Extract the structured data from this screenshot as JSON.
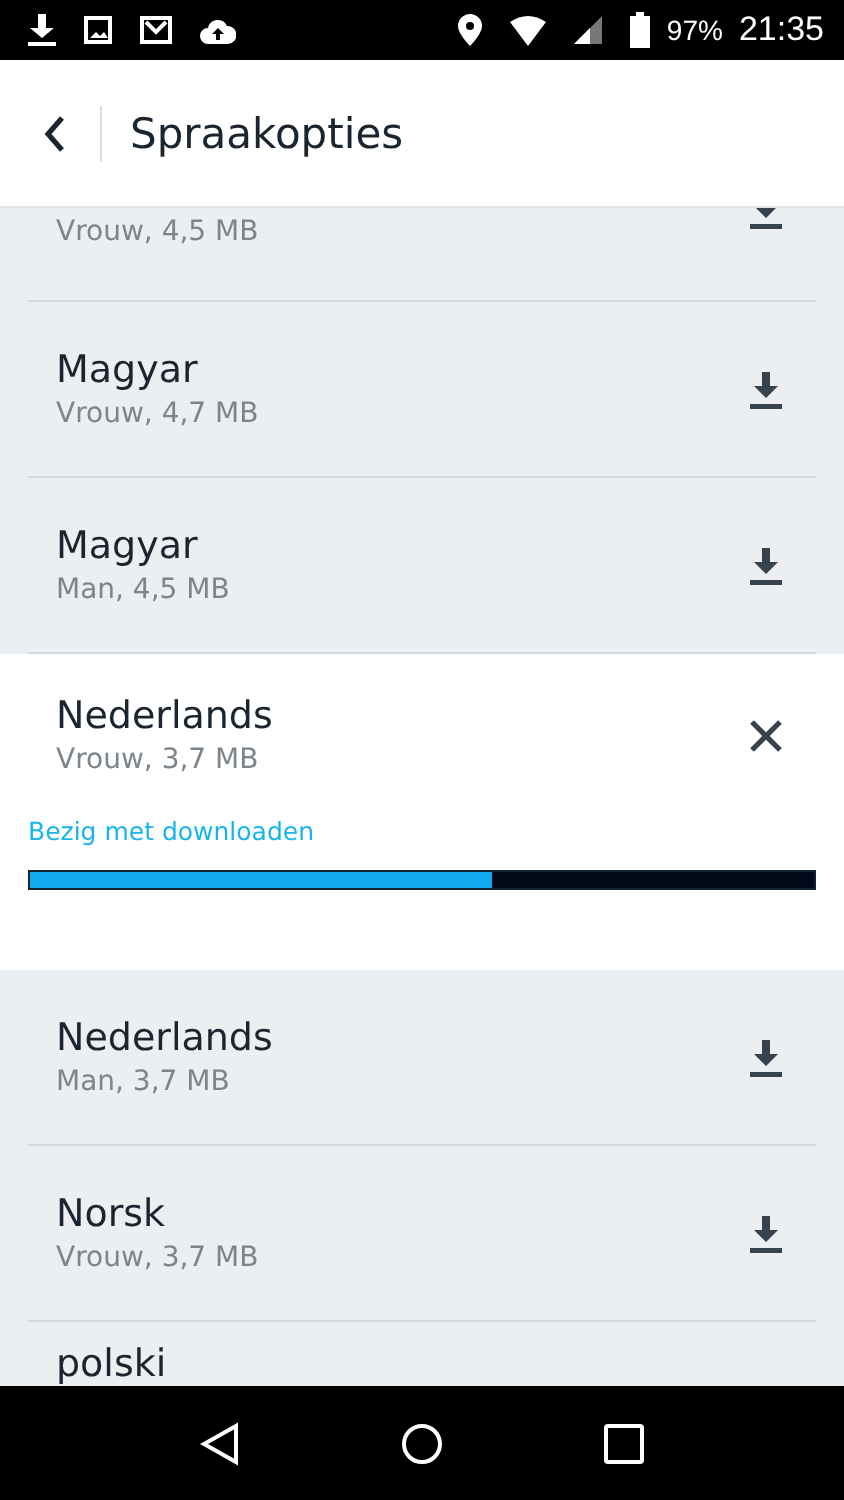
{
  "status_bar": {
    "battery": "97%",
    "time": "21:35"
  },
  "header": {
    "title": "Spraakopties"
  },
  "voices": [
    {
      "kind": "partial",
      "subtitle": "Vrouw, 4,5 MB"
    },
    {
      "kind": "available",
      "title": "Magyar",
      "subtitle": "Vrouw, 4,7 MB"
    },
    {
      "kind": "available",
      "title": "Magyar",
      "subtitle": "Man, 4,5 MB"
    },
    {
      "kind": "downloading",
      "title": "Nederlands",
      "subtitle": "Vrouw, 3,7 MB",
      "status": "Bezig met downloaden",
      "level": 0.59
    },
    {
      "kind": "available",
      "title": "Nederlands",
      "subtitle": "Man, 3,7 MB"
    },
    {
      "kind": "available",
      "title": "Norsk",
      "subtitle": "Vrouw, 3,7 MB"
    },
    {
      "kind": "available",
      "title": "polski"
    }
  ]
}
